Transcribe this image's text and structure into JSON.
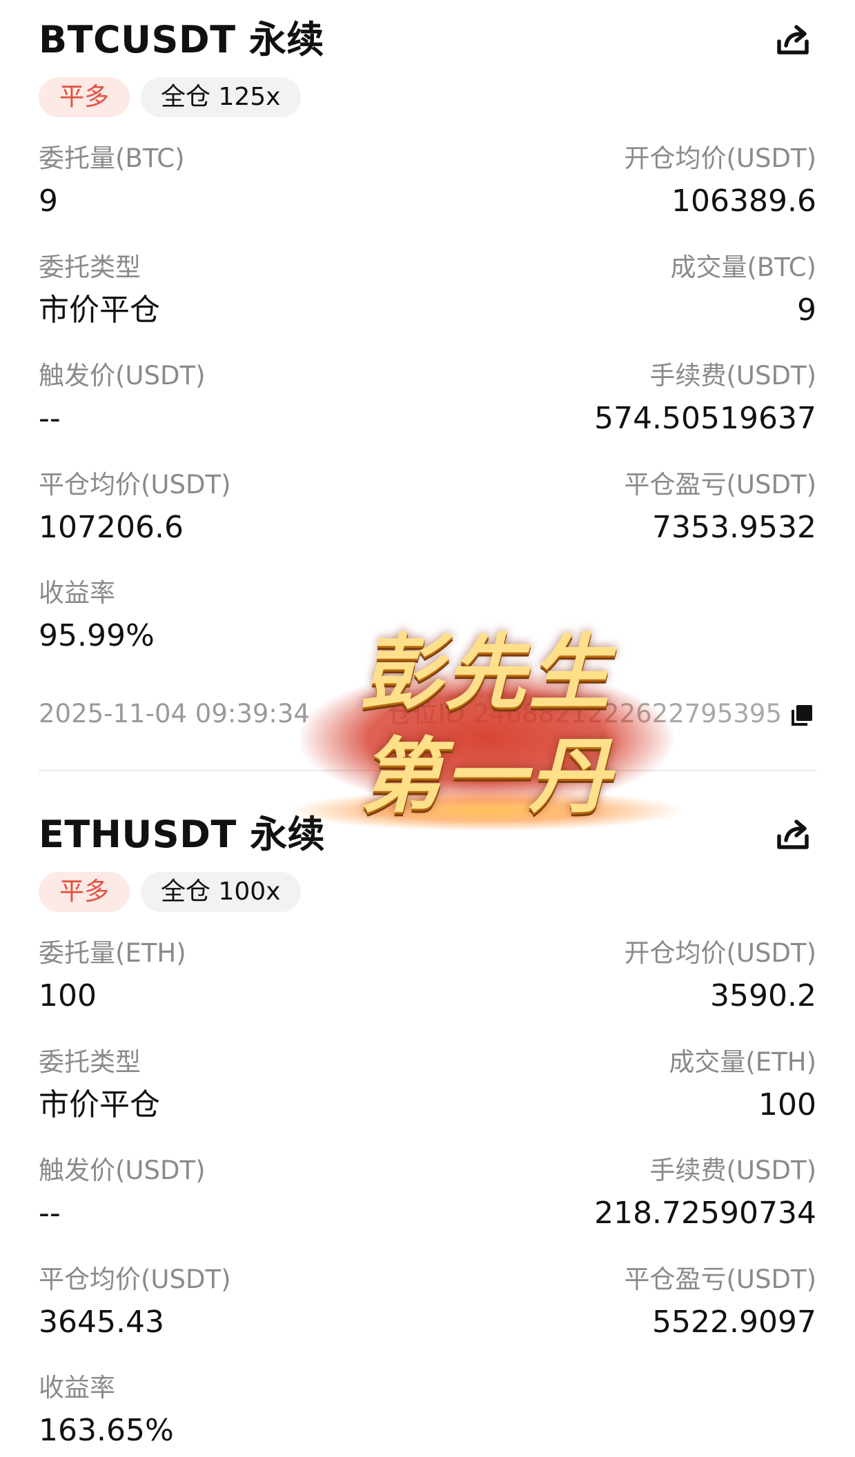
{
  "cards": [
    {
      "title": "BTCUSDT 永续",
      "tag_side": "平多",
      "tag_margin": "全仓 125x",
      "order_qty_label": "委托量(BTC)",
      "order_qty_value": "9",
      "open_avg_label": "开仓均价(USDT)",
      "open_avg_value": "106389.6",
      "order_type_label": "委托类型",
      "order_type_value": "市价平仓",
      "filled_qty_label": "成交量(BTC)",
      "filled_qty_value": "9",
      "trigger_label": "触发价(USDT)",
      "trigger_value": "--",
      "fee_label": "手续费(USDT)",
      "fee_value": "574.50519637",
      "close_avg_label": "平仓均价(USDT)",
      "close_avg_value": "107206.6",
      "pnl_label": "平仓盈亏(USDT)",
      "pnl_value": "7353.9532",
      "roi_label": "收益率",
      "roi_value": "95.99%",
      "timestamp": "2025-11-04 09:39:34",
      "position_id": "仓位ID 2468821222622795395"
    },
    {
      "title": "ETHUSDT 永续",
      "tag_side": "平多",
      "tag_margin": "全仓 100x",
      "order_qty_label": "委托量(ETH)",
      "order_qty_value": "100",
      "open_avg_label": "开仓均价(USDT)",
      "open_avg_value": "3590.2",
      "order_type_label": "委托类型",
      "order_type_value": "市价平仓",
      "filled_qty_label": "成交量(ETH)",
      "filled_qty_value": "100",
      "trigger_label": "触发价(USDT)",
      "trigger_value": "--",
      "fee_label": "手续费(USDT)",
      "fee_value": "218.72590734",
      "close_avg_label": "平仓均价(USDT)",
      "close_avg_value": "3645.43",
      "pnl_label": "平仓盈亏(USDT)",
      "pnl_value": "5522.9097",
      "roi_label": "收益率",
      "roi_value": "163.65%"
    }
  ],
  "watermark": {
    "line1": "彭先生",
    "line2": "第一丹"
  },
  "icons": {
    "share": "share-icon",
    "copy": "copy-icon"
  },
  "colors": {
    "tag_side_bg": "#fde9e6",
    "tag_side_text": "#e2503f",
    "tag_margin_bg": "#f2f2f2",
    "label_gray": "#8a8a8a"
  }
}
